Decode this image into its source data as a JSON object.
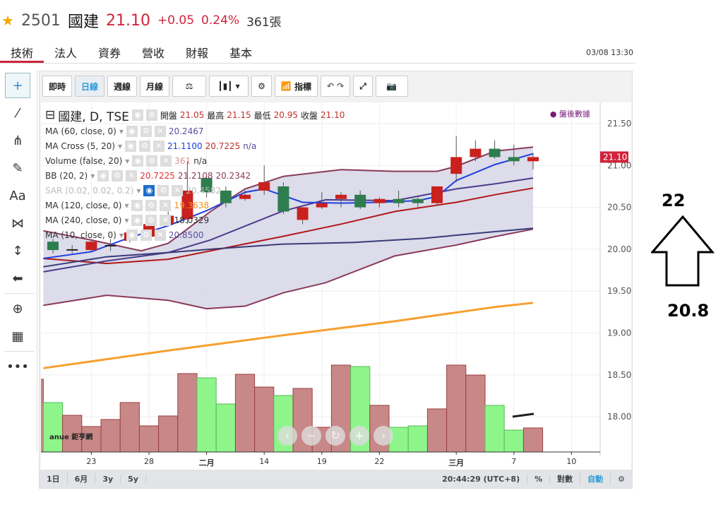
{
  "header": {
    "code": "2501",
    "name": "國建",
    "price": "21.10",
    "change": "+0.05",
    "pct": "0.24%",
    "volume": "361張"
  },
  "tabs": [
    "技術",
    "法人",
    "資券",
    "營收",
    "財報",
    "基本"
  ],
  "timestamp": "03/08 13:30",
  "toolbar": {
    "realtime": "即時",
    "daily": "日線",
    "weekly": "週線",
    "monthly": "月線",
    "indicators": "指標"
  },
  "chart_title": "國建, D, TSE",
  "ohlc": {
    "open_label": "開盤",
    "open": "21.05",
    "high_label": "最高",
    "high": "21.15",
    "low_label": "最低",
    "low": "20.95",
    "close_label": "收盤",
    "close": "21.10"
  },
  "after_hours": "盤後數據",
  "legend": [
    {
      "label": "MA (60, close, 0)",
      "vals": [
        {
          "v": "20.2467",
          "c": "#5a4fa0"
        }
      ]
    },
    {
      "label": "MA Cross (5, 20)",
      "vals": [
        {
          "v": "21.1100",
          "c": "#1f3fe0"
        },
        {
          "v": "20.7225",
          "c": "#c0302a"
        },
        {
          "v": "n/a",
          "c": "#5a4fa0"
        }
      ]
    },
    {
      "label": "Volume (false, 20)",
      "vals": [
        {
          "v": "361",
          "c": "#d89090"
        },
        {
          "v": "n/a",
          "c": "#333"
        }
      ]
    },
    {
      "label": "BB (20, 2)",
      "vals": [
        {
          "v": "20.7225",
          "c": "#e03030"
        },
        {
          "v": "21.2108",
          "c": "#8a3a5a"
        },
        {
          "v": "20.2342",
          "c": "#8a3a5a"
        }
      ]
    },
    {
      "label": "SAR (0.02, 0.02, 0.2)",
      "vals": [
        {
          "v": "20.4582",
          "c": "#bbb"
        }
      ],
      "hidden": true
    },
    {
      "label": "MA (120, close, 0)",
      "vals": [
        {
          "v": "19.3638",
          "c": "#f7931e"
        }
      ]
    },
    {
      "label": "MA (240, close, 0)",
      "vals": [
        {
          "v": "18.0329",
          "c": "#333"
        }
      ]
    },
    {
      "label": "MA (10, close, 0)",
      "vals": [
        {
          "v": "20.8500",
          "c": "#5a4fa0"
        }
      ]
    }
  ],
  "bottom": {
    "ranges": [
      "1日",
      "6月",
      "3y",
      "5y"
    ],
    "clock": "20:44:29 (UTC+8)",
    "pct": "%",
    "log": "對數",
    "auto": "自動"
  },
  "annotation": {
    "top": "22",
    "bottom": "20.8"
  },
  "logo": "anue 鉅亨網",
  "chart_data": {
    "type": "candlestick",
    "yticks": [
      "21.50",
      "21.00",
      "20.50",
      "20.00",
      "19.50",
      "19.00",
      "18.50",
      "18.00"
    ],
    "ylim": [
      17.7,
      21.75
    ],
    "last_price_tag": "21.10",
    "xticks": [
      {
        "i": 2,
        "t": "23"
      },
      {
        "i": 5,
        "t": "28"
      },
      {
        "i": 8,
        "t": "二月",
        "b": true
      },
      {
        "i": 11,
        "t": "14"
      },
      {
        "i": 14,
        "t": "19"
      },
      {
        "i": 17,
        "t": "22"
      },
      {
        "i": 21,
        "t": "三月",
        "b": true
      },
      {
        "i": 24,
        "t": "7"
      },
      {
        "i": 27,
        "t": "10"
      }
    ],
    "candles": [
      [
        20.09,
        20.12,
        19.95,
        19.99
      ],
      [
        20.0,
        20.05,
        19.95,
        20.0
      ],
      [
        19.99,
        20.12,
        19.97,
        20.09
      ],
      [
        20.05,
        20.12,
        19.98,
        20.05
      ],
      [
        20.1,
        20.22,
        20.08,
        20.2
      ],
      [
        20.15,
        20.33,
        20.12,
        20.3
      ],
      [
        20.3,
        20.45,
        20.28,
        20.4
      ],
      [
        20.36,
        21.05,
        20.3,
        20.7
      ],
      [
        20.85,
        20.9,
        20.62,
        20.68
      ],
      [
        20.7,
        20.75,
        20.5,
        20.55
      ],
      [
        20.6,
        20.7,
        20.58,
        20.65
      ],
      [
        20.7,
        21.0,
        20.65,
        20.8
      ],
      [
        20.75,
        20.8,
        20.42,
        20.45
      ],
      [
        20.35,
        20.5,
        20.3,
        20.5
      ],
      [
        20.5,
        20.68,
        20.48,
        20.55
      ],
      [
        20.6,
        20.68,
        20.5,
        20.65
      ],
      [
        20.65,
        20.7,
        20.48,
        20.5
      ],
      [
        20.55,
        20.62,
        20.5,
        20.6
      ],
      [
        20.6,
        20.7,
        20.5,
        20.55
      ],
      [
        20.6,
        20.62,
        20.5,
        20.55
      ],
      [
        20.55,
        20.75,
        20.52,
        20.75
      ],
      [
        20.9,
        21.35,
        20.8,
        21.1
      ],
      [
        21.1,
        21.3,
        21.05,
        21.2
      ],
      [
        21.2,
        21.3,
        21.08,
        21.1
      ],
      [
        21.1,
        21.25,
        21.0,
        21.05
      ],
      [
        21.05,
        21.15,
        20.95,
        21.1
      ]
    ],
    "volume": [
      1092,
      742,
      551,
      382,
      488,
      742,
      392,
      541,
      1177,
      1113,
      721,
      1166,
      975,
      848,
      954,
      371,
      1304,
      1283,
      700,
      371,
      392,
      647,
      1304,
      1155,
      700,
      329,
      361
    ],
    "volume_start_index": -1,
    "lines": [
      {
        "name": "BB upper",
        "color": "#8a3a5a",
        "pts": [
          [
            -0.5,
            20.22
          ],
          [
            2,
            20.11
          ],
          [
            4.6,
            19.98
          ],
          [
            6,
            20.07
          ],
          [
            8.2,
            20.45
          ],
          [
            10,
            20.72
          ],
          [
            12,
            20.87
          ],
          [
            15,
            20.95
          ],
          [
            17.8,
            20.93
          ],
          [
            20,
            20.93
          ],
          [
            21,
            20.99
          ],
          [
            23,
            21.17
          ],
          [
            25,
            21.22
          ]
        ]
      },
      {
        "name": "BB lower",
        "color": "#8a3a5a",
        "pts": [
          [
            -0.5,
            19.33
          ],
          [
            2.8,
            19.45
          ],
          [
            6,
            19.39
          ],
          [
            8,
            19.29
          ],
          [
            10,
            19.32
          ],
          [
            12,
            19.48
          ],
          [
            14.2,
            19.6
          ],
          [
            17.8,
            19.92
          ],
          [
            21,
            20.05
          ],
          [
            23,
            20.15
          ],
          [
            25,
            20.24
          ]
        ]
      },
      {
        "name": "MA20",
        "color": "#b01818",
        "pts": [
          [
            -0.5,
            19.89
          ],
          [
            2.8,
            19.83
          ],
          [
            6,
            19.88
          ],
          [
            8.2,
            19.98
          ],
          [
            11.9,
            20.15
          ],
          [
            15,
            20.3
          ],
          [
            17.8,
            20.45
          ],
          [
            21,
            20.56
          ],
          [
            23,
            20.65
          ],
          [
            25,
            20.73
          ]
        ]
      },
      {
        "name": "MA60",
        "color": "#4a3c8a",
        "pts": [
          [
            -0.5,
            19.73
          ],
          [
            2.8,
            19.86
          ],
          [
            6,
            19.96
          ],
          [
            8.2,
            20.11
          ],
          [
            11.9,
            20.45
          ],
          [
            14.2,
            20.59
          ],
          [
            17.8,
            20.58
          ],
          [
            21,
            20.72
          ],
          [
            23,
            20.78
          ],
          [
            25,
            20.85
          ]
        ]
      },
      {
        "name": "MA5",
        "color": "#1f3fe0",
        "pts": [
          [
            -0.5,
            19.89
          ],
          [
            2,
            19.97
          ],
          [
            4,
            20.14
          ],
          [
            6,
            20.28
          ],
          [
            8,
            20.46
          ],
          [
            10,
            20.68
          ],
          [
            11,
            20.72
          ],
          [
            13,
            20.56
          ],
          [
            15,
            20.55
          ],
          [
            17,
            20.56
          ],
          [
            19,
            20.58
          ],
          [
            20,
            20.63
          ],
          [
            21,
            20.82
          ],
          [
            23,
            21.01
          ],
          [
            25,
            21.14
          ]
        ]
      },
      {
        "name": "MA240",
        "color": "#3a3a7a",
        "pts": [
          [
            -0.5,
            19.79
          ],
          [
            2.8,
            19.91
          ],
          [
            6,
            19.96
          ],
          [
            8.2,
            20.0
          ],
          [
            11.9,
            20.06
          ],
          [
            15.6,
            20.08
          ],
          [
            19.3,
            20.13
          ],
          [
            23,
            20.21
          ],
          [
            25,
            20.25
          ]
        ]
      },
      {
        "name": "MA120",
        "color": "#f7a030",
        "pts": [
          [
            -0.5,
            18.58
          ],
          [
            6,
            18.79
          ],
          [
            11.9,
            18.97
          ],
          [
            17.8,
            19.14
          ],
          [
            23,
            19.31
          ],
          [
            25,
            19.36
          ]
        ]
      }
    ]
  }
}
